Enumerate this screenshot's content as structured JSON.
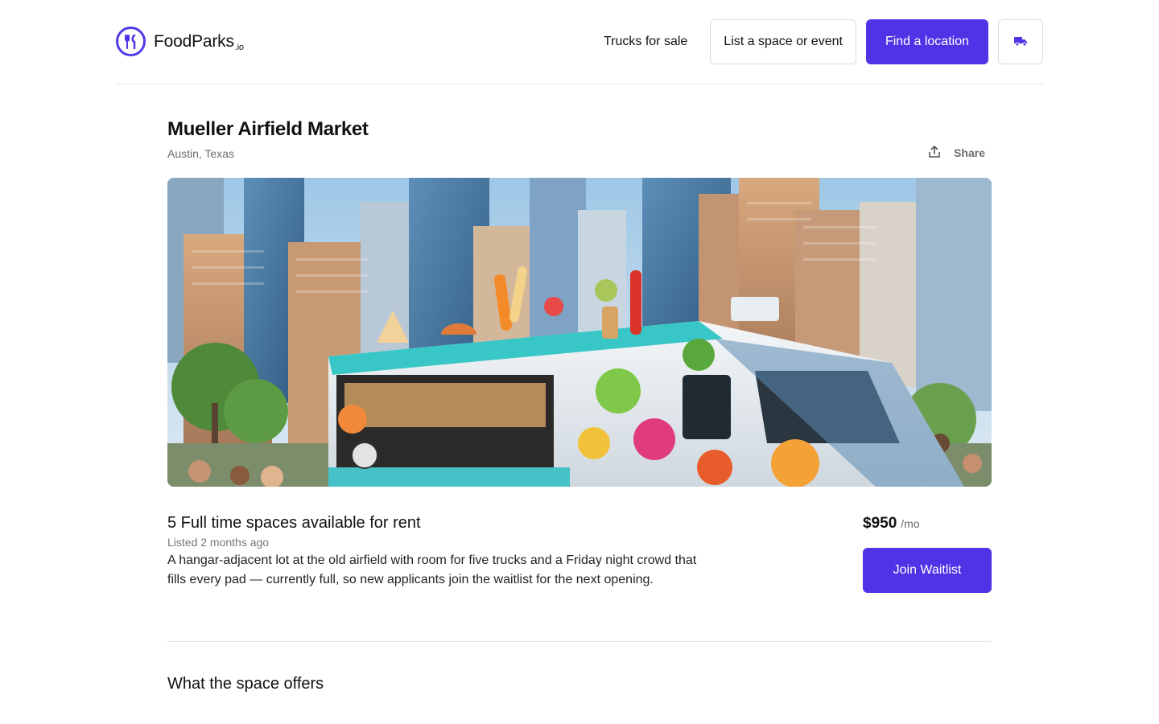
{
  "brand": {
    "name": "FoodParks",
    "suffix": ".io",
    "color": "#4f33e6"
  },
  "nav": {
    "trucks_for_sale": "Trucks for sale",
    "list_space": "List a space or event",
    "find_location": "Find a location",
    "truck_icon": "truck-icon"
  },
  "listing": {
    "title": "Mueller Airfield Market",
    "location": "Austin, Texas",
    "share_label": "Share",
    "spaces_title": "5 Full time spaces available for rent",
    "listed": "Listed 2 months ago",
    "description": "A hangar-adjacent lot at the old airfield with room for five trucks and a Friday night crowd that fills every pad — currently full, so new applicants join the waitlist for the next opening.",
    "price": "$950",
    "price_unit": "/mo",
    "cta": "Join Waitlist"
  },
  "sections": {
    "offers_title": "What the space offers"
  }
}
